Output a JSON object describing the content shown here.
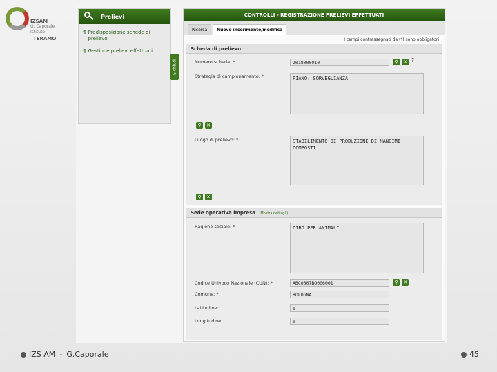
{
  "logo": {
    "name": "IZSAM",
    "line2": "G. Caporale",
    "line3": "Istituto",
    "city": "TERAMO"
  },
  "left_panel": {
    "title": "Prelievi",
    "items": [
      {
        "label": "Predisposizione schede di prelievo"
      },
      {
        "label": "Gestione prelievi effettuati"
      }
    ],
    "side_tab": "E chiudi"
  },
  "main": {
    "title": "CONTROLLI - REGISTRAZIONE PRELIEVI EFFETTUATI",
    "tabs": [
      "Ricerca",
      "Nuovo inserimento/modifica"
    ],
    "required_note": "I campi contrassegnati da (*) sono obbligatori",
    "scheda": {
      "title": "Scheda di prelievo",
      "numero_label": "Numero scheda: *",
      "numero_value": "2018000010",
      "strategia_label": "Strategia di campionamento: *",
      "strategia_value": "PIANO: SORVEGLIANZA",
      "luogo_label": "Luogo di prelievo: *",
      "luogo_value": "STABILIMENTO DI PRODUZIONE DI MANGIMI COMPOSTI"
    },
    "sede": {
      "title": "Sede operativa impresa",
      "details_link": "(Mostra dettagli)",
      "ragione_label": "Ragione sociale: *",
      "ragione_value": "CIBO PER ANIMALI",
      "cun_label": "Codice Univoco Nazionale (CUN): *",
      "cun_value": "ABC0007BO006001",
      "comune_label": "Comune: *",
      "comune_value": "BOLOGNA",
      "lat_label": "Latitudine:",
      "lat_value": "0",
      "lon_label": "Longitudine:",
      "lon_value": "0"
    }
  },
  "icons": {
    "search": "search-icon",
    "clear": "✕",
    "help": "?"
  },
  "footer": {
    "org": "IZS AM",
    "sep": "-",
    "author": "G.Caporale",
    "page": "45"
  }
}
